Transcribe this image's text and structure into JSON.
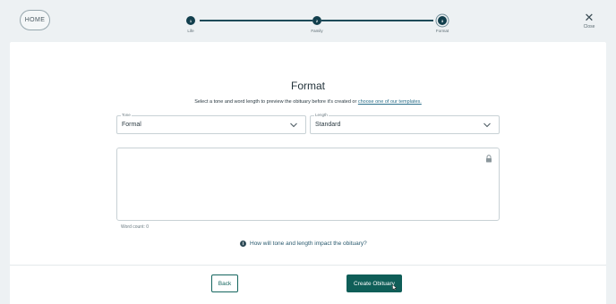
{
  "header": {
    "home_label": "HOME",
    "close_label": "Close",
    "close_glyph": "✕",
    "steps": [
      {
        "number": "1",
        "label": "Life"
      },
      {
        "number": "2",
        "label": "Family"
      },
      {
        "number": "3",
        "label": "Format"
      }
    ],
    "current_step": 3
  },
  "main": {
    "title": "Format",
    "subtitle_text": "Select a tone and word length to preview the obituary before it's created or",
    "subtitle_link": "choose one of our templates.",
    "tone": {
      "label": "Tone",
      "value": "Formal"
    },
    "length": {
      "label": "Length",
      "value": "Standard"
    },
    "word_count": "Word count: 0",
    "help_text": "How will tone and length impact the obituary?"
  },
  "footer": {
    "back_label": "Back",
    "create_label": "Create Obituary"
  },
  "icons": {
    "lock": "lock-icon",
    "info": "info-icon",
    "chevron": "chevron-down-icon",
    "close": "close-icon"
  },
  "colors": {
    "accent": "#0f5e58",
    "step_active": "#123f4d",
    "background": "#edf1f3"
  }
}
